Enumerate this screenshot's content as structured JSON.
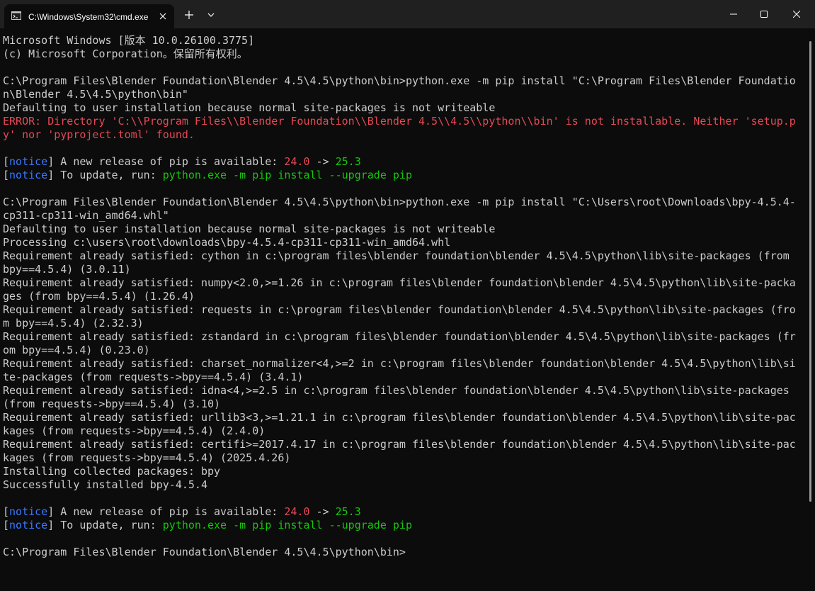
{
  "tab": {
    "title": "C:\\Windows\\System32\\cmd.exe",
    "icon": "cmd-icon"
  },
  "toolbar": {
    "new_tab_label": "+",
    "dropdown_label": "⌄"
  },
  "window_controls": {
    "minimize_label": "—",
    "maximize_label": "☐",
    "close_label": "✕"
  },
  "console": {
    "l0": "Microsoft Windows [版本 10.0.26100.3775]",
    "l1": "(c) Microsoft Corporation。保留所有权利。",
    "l3": "C:\\Program Files\\Blender Foundation\\Blender 4.5\\4.5\\python\\bin>python.exe -m pip install \"C:\\Program Files\\Blender Foundatio",
    "l4": "n\\Blender 4.5\\4.5\\python\\bin\"",
    "l5": "Defaulting to user installation because normal site-packages is not writeable",
    "l6": "ERROR: Directory 'C:\\\\Program Files\\\\Blender Foundation\\\\Blender 4.5\\\\4.5\\\\python\\\\bin' is not installable. Neither 'setup.p",
    "l7": "y' nor 'pyproject.toml' found.",
    "notice1": {
      "b_open": "[",
      "tag": "notice",
      "b_close": "]",
      "text1": " A new release of pip is available: ",
      "old": "24.0",
      "arrow": " -> ",
      "new": "25.3"
    },
    "notice2": {
      "b_open": "[",
      "tag": "notice",
      "b_close": "]",
      "text1": " To update, run: ",
      "cmd": "python.exe -m pip install --upgrade pip"
    },
    "l12": "C:\\Program Files\\Blender Foundation\\Blender 4.5\\4.5\\python\\bin>python.exe -m pip install \"C:\\Users\\root\\Downloads\\bpy-4.5.4-",
    "l13": "cp311-cp311-win_amd64.whl\"",
    "l14": "Defaulting to user installation because normal site-packages is not writeable",
    "l15": "Processing c:\\users\\root\\downloads\\bpy-4.5.4-cp311-cp311-win_amd64.whl",
    "l16": "Requirement already satisfied: cython in c:\\program files\\blender foundation\\blender 4.5\\4.5\\python\\lib\\site-packages (from",
    "l17": "bpy==4.5.4) (3.0.11)",
    "l18": "Requirement already satisfied: numpy<2.0,>=1.26 in c:\\program files\\blender foundation\\blender 4.5\\4.5\\python\\lib\\site-packa",
    "l19": "ges (from bpy==4.5.4) (1.26.4)",
    "l20": "Requirement already satisfied: requests in c:\\program files\\blender foundation\\blender 4.5\\4.5\\python\\lib\\site-packages (fro",
    "l21": "m bpy==4.5.4) (2.32.3)",
    "l22": "Requirement already satisfied: zstandard in c:\\program files\\blender foundation\\blender 4.5\\4.5\\python\\lib\\site-packages (fr",
    "l23": "om bpy==4.5.4) (0.23.0)",
    "l24": "Requirement already satisfied: charset_normalizer<4,>=2 in c:\\program files\\blender foundation\\blender 4.5\\4.5\\python\\lib\\si",
    "l25": "te-packages (from requests->bpy==4.5.4) (3.4.1)",
    "l26": "Requirement already satisfied: idna<4,>=2.5 in c:\\program files\\blender foundation\\blender 4.5\\4.5\\python\\lib\\site-packages",
    "l27": "(from requests->bpy==4.5.4) (3.10)",
    "l28": "Requirement already satisfied: urllib3<3,>=1.21.1 in c:\\program files\\blender foundation\\blender 4.5\\4.5\\python\\lib\\site-pac",
    "l29": "kages (from requests->bpy==4.5.4) (2.4.0)",
    "l30": "Requirement already satisfied: certifi>=2017.4.17 in c:\\program files\\blender foundation\\blender 4.5\\4.5\\python\\lib\\site-pac",
    "l31": "kages (from requests->bpy==4.5.4) (2025.4.26)",
    "l32": "Installing collected packages: bpy",
    "l33": "Successfully installed bpy-4.5.4",
    "notice3": {
      "b_open": "[",
      "tag": "notice",
      "b_close": "]",
      "text1": " A new release of pip is available: ",
      "old": "24.0",
      "arrow": " -> ",
      "new": "25.3"
    },
    "notice4": {
      "b_open": "[",
      "tag": "notice",
      "b_close": "]",
      "text1": " To update, run: ",
      "cmd": "python.exe -m pip install --upgrade pip"
    },
    "l38": "C:\\Program Files\\Blender Foundation\\Blender 4.5\\4.5\\python\\bin>"
  },
  "colors": {
    "background": "#0c0c0c",
    "titlebar": "#202020",
    "text": "#cccccc",
    "error": "#e74856",
    "notice": "#3b78ff",
    "success": "#16c60c"
  }
}
